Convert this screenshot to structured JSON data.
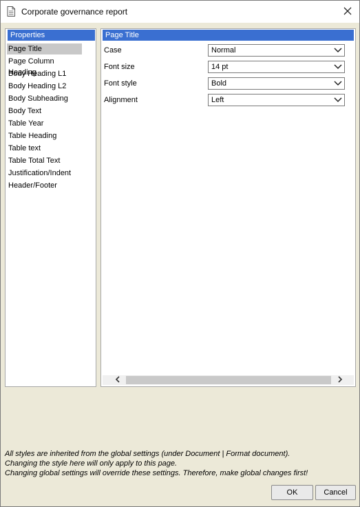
{
  "window": {
    "title": "Corporate governance report",
    "icon": "document-icon",
    "close_icon": "close-icon"
  },
  "left_panel": {
    "header": "Properties",
    "items": [
      {
        "label": "Page Title",
        "selected": true
      },
      {
        "label": "Page Column Heading"
      },
      {
        "label": "Body Heading L1"
      },
      {
        "label": "Body Heading L2"
      },
      {
        "label": "Body Subheading"
      },
      {
        "label": "Body Text"
      },
      {
        "label": "Table Year"
      },
      {
        "label": "Table Heading"
      },
      {
        "label": "Table text"
      },
      {
        "label": "Table Total Text"
      },
      {
        "label": "Justification/Indent"
      },
      {
        "label": "Header/Footer"
      }
    ]
  },
  "right_panel": {
    "header": "Page Title",
    "fields": [
      {
        "label": "Case",
        "value": "Normal"
      },
      {
        "label": "Font size",
        "value": "14 pt"
      },
      {
        "label": "Font style",
        "value": "Bold"
      },
      {
        "label": "Alignment",
        "value": "Left"
      }
    ]
  },
  "notes": [
    "All styles are inherited from the global settings (under Document | Format document).",
    "Changing the style here will only apply to this page.",
    "Changing global settings will override these settings. Therefore, make global changes first!"
  ],
  "buttons": {
    "ok": "OK",
    "cancel": "Cancel"
  },
  "colors": {
    "header_bg": "#3a6fd1",
    "selected_bg": "#c8c8c8",
    "dialog_bg": "#ece9d8"
  }
}
